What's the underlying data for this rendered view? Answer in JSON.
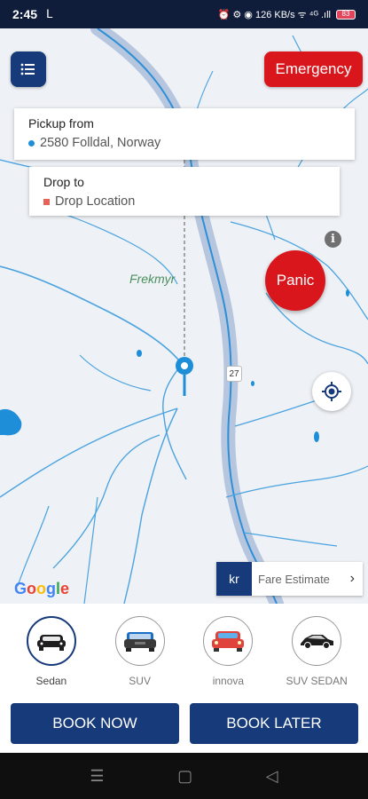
{
  "status_bar": {
    "time": "2:45",
    "indicators": "⏰ ⚙ ◉ 126 KB/s ᯤ ⁴ᴳ .ıll",
    "battery": "83",
    "icons": [
      "alarm-icon",
      "settings-icon",
      "location-icon",
      "wifi-icon",
      "signal-icon",
      "battery-icon"
    ]
  },
  "header": {
    "menu_icon": "list-icon",
    "emergency_label": "Emergency"
  },
  "pickup": {
    "title": "Pickup from",
    "value": "2580 Folldal, Norway"
  },
  "drop": {
    "title": "Drop to",
    "value": "Drop Location"
  },
  "map": {
    "place_label": "Frekmyr",
    "road_number": "27",
    "info_icon": "i",
    "panic_label": "Panic",
    "google_logo": "Google",
    "locate_icon": "crosshair-icon"
  },
  "fare": {
    "currency": "kr",
    "label": "Fare Estimate",
    "chevron": "›"
  },
  "vehicles": [
    {
      "label": "Sedan",
      "icon": "sedan-car-icon",
      "selected": true
    },
    {
      "label": "SUV",
      "icon": "suv-car-icon",
      "selected": false
    },
    {
      "label": "innova",
      "icon": "innova-car-icon",
      "selected": false
    },
    {
      "label": "SUV SEDAN",
      "icon": "suv-sedan-car-icon",
      "selected": false
    }
  ],
  "actions": {
    "book_now": "BOOK NOW",
    "book_later": "BOOK LATER"
  },
  "nav": {
    "recent": "☰",
    "home": "▢",
    "back": "◁"
  },
  "colors": {
    "primary": "#173a7a",
    "danger": "#d9161c",
    "water": "#1e8ed8"
  }
}
